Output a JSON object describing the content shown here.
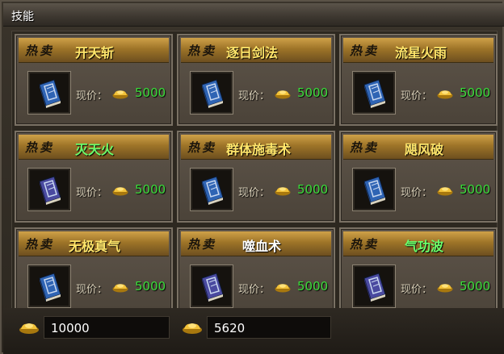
{
  "window": {
    "title": "技能"
  },
  "labels": {
    "hot": "热卖",
    "price": "现价："
  },
  "colors": {
    "name_gold": "#ffe66b",
    "name_green": "#6bff6b",
    "name_white": "#ffffff",
    "price_green": "#3adc3a"
  },
  "items": [
    {
      "name": "开天斩",
      "price": "5000",
      "name_color": "gold",
      "icon": "blue-book-icon"
    },
    {
      "name": "逐日剑法",
      "price": "5000",
      "name_color": "gold",
      "icon": "blue-book-icon"
    },
    {
      "name": "流星火雨",
      "price": "5000",
      "name_color": "gold",
      "icon": "blue-book-icon"
    },
    {
      "name": "灭天火",
      "price": "5000",
      "name_color": "green",
      "icon": "purple-book-icon"
    },
    {
      "name": "群体施毒术",
      "price": "5000",
      "name_color": "gold",
      "icon": "blue-book-icon"
    },
    {
      "name": "飓风破",
      "price": "5000",
      "name_color": "gold",
      "icon": "blue-book-icon"
    },
    {
      "name": "无极真气",
      "price": "5000",
      "name_color": "gold",
      "icon": "blue-book-icon"
    },
    {
      "name": "噬血术",
      "price": "5000",
      "name_color": "white",
      "icon": "purple-book-icon"
    },
    {
      "name": "气功波",
      "price": "5000",
      "name_color": "green",
      "icon": "purple-book-icon"
    }
  ],
  "currency": {
    "gold": "10000",
    "yuanbao": "5620"
  }
}
